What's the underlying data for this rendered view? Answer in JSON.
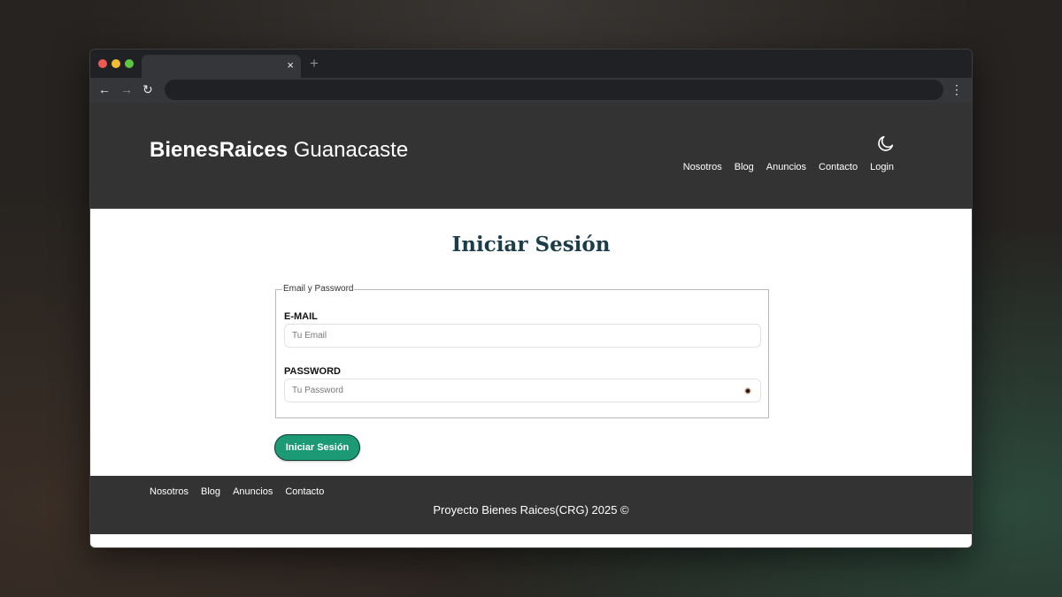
{
  "browser": {
    "tab_close": "×",
    "new_tab": "+",
    "back": "←",
    "forward": "→",
    "reload": "↻",
    "menu": "⋮",
    "address": ""
  },
  "header": {
    "logo_bold": "BienesRaices",
    "logo_light": " Guanacaste",
    "theme_icon": "moon-icon",
    "nav": [
      "Nosotros",
      "Blog",
      "Anuncios",
      "Contacto",
      "Login"
    ]
  },
  "main": {
    "title": "Iniciar Sesión",
    "fieldset_legend": "Email y Password",
    "email_label": "E-MAIL",
    "email_placeholder": "Tu Email",
    "email_value": "",
    "password_label": "PASSWORD",
    "password_placeholder": "Tu Password",
    "password_value": "",
    "password_toggle_icon": "eye-icon",
    "submit_label": "Iniciar Sesión"
  },
  "footer": {
    "nav": [
      "Nosotros",
      "Blog",
      "Anuncios",
      "Contacto"
    ],
    "copyright": "Proyecto Bienes Raices(CRG) 2025 ©"
  },
  "colors": {
    "header_bg": "#333333",
    "title_color": "#1b3d4a",
    "button_bg": "#1c9a76"
  }
}
